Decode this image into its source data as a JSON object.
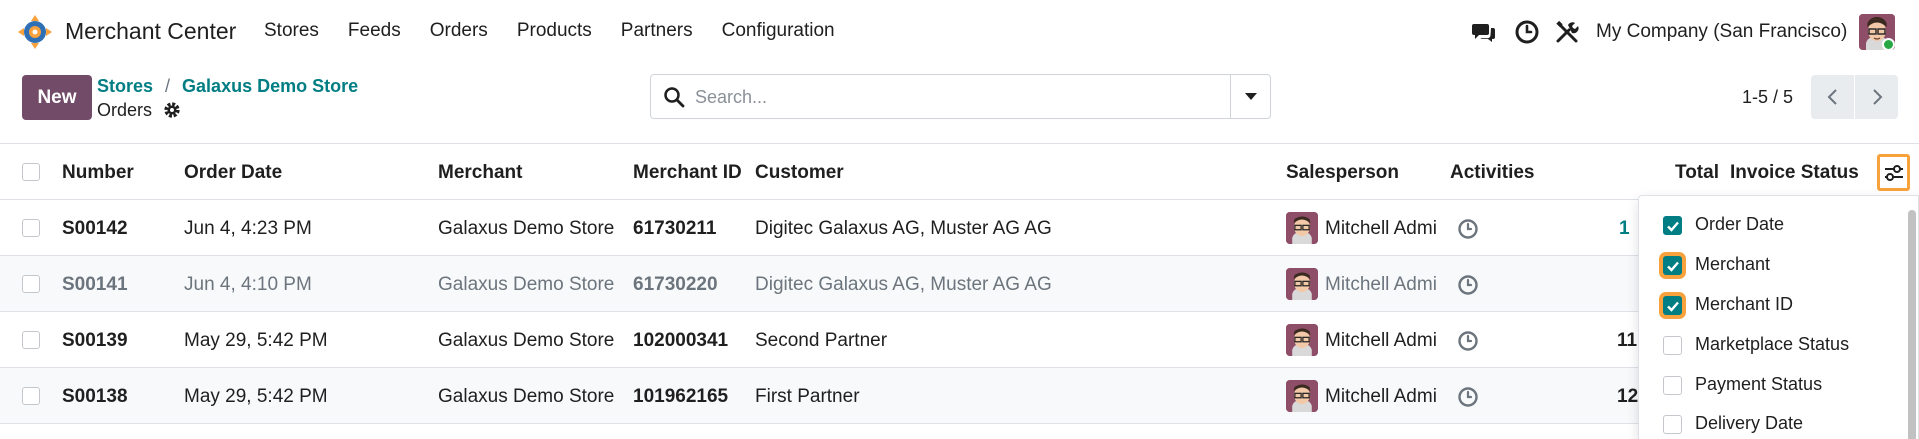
{
  "app": {
    "title": "Merchant Center",
    "menu": [
      "Stores",
      "Feeds",
      "Orders",
      "Products",
      "Partners",
      "Configuration"
    ],
    "company": "My Company (San Francisco)",
    "brand_color": "#714b67",
    "accent_color": "#017e84"
  },
  "control_panel": {
    "new_label": "New",
    "breadcrumb": [
      "Stores",
      "Galaxus Demo Store"
    ],
    "breadcrumb_sep": "/",
    "page_title": "Orders",
    "search_placeholder": "Search...",
    "pager": "1-5 / 5"
  },
  "table": {
    "columns": {
      "number": "Number",
      "order_date": "Order Date",
      "merchant": "Merchant",
      "merchant_id": "Merchant ID",
      "customer": "Customer",
      "salesperson": "Salesperson",
      "activities": "Activities",
      "total": "Total",
      "invoice_status": "Invoice Status"
    },
    "rows": [
      {
        "number": "S00142",
        "order_date": "Jun 4, 4:23 PM",
        "merchant": "Galaxus Demo Store",
        "merchant_id": "61730211",
        "customer": "Digitec Galaxus AG, Muster AG AG",
        "salesperson": "Mitchell Admi",
        "total": "1"
      },
      {
        "number": "S00141",
        "order_date": "Jun 4, 4:10 PM",
        "merchant": "Galaxus Demo Store",
        "merchant_id": "61730220",
        "customer": "Digitec Galaxus AG, Muster AG AG",
        "salesperson": "Mitchell Admi",
        "total": ""
      },
      {
        "number": "S00139",
        "order_date": "May 29, 5:42 PM",
        "merchant": "Galaxus Demo Store",
        "merchant_id": "102000341",
        "customer": "Second Partner",
        "salesperson": "Mitchell Admi",
        "total": "11"
      },
      {
        "number": "S00138",
        "order_date": "May 29, 5:42 PM",
        "merchant": "Galaxus Demo Store",
        "merchant_id": "101962165",
        "customer": "First Partner",
        "salesperson": "Mitchell Admi",
        "total": "12"
      }
    ]
  },
  "optional_columns": [
    {
      "label": "Order Date",
      "checked": true,
      "focus": false
    },
    {
      "label": "Merchant",
      "checked": true,
      "focus": true
    },
    {
      "label": "Merchant ID",
      "checked": true,
      "focus": true
    },
    {
      "label": "Marketplace Status",
      "checked": false,
      "focus": false
    },
    {
      "label": "Payment Status",
      "checked": false,
      "focus": false
    },
    {
      "label": "Delivery Date",
      "checked": false,
      "focus": false
    }
  ],
  "icons": {
    "logo": "merchant-center-logo",
    "chat": "chat-icon",
    "activity": "clock-icon",
    "debug": "tools-icon",
    "settings": "gear-icon",
    "search": "search-icon",
    "optional": "sliders-icon"
  },
  "focus_color": "#f7a23c"
}
